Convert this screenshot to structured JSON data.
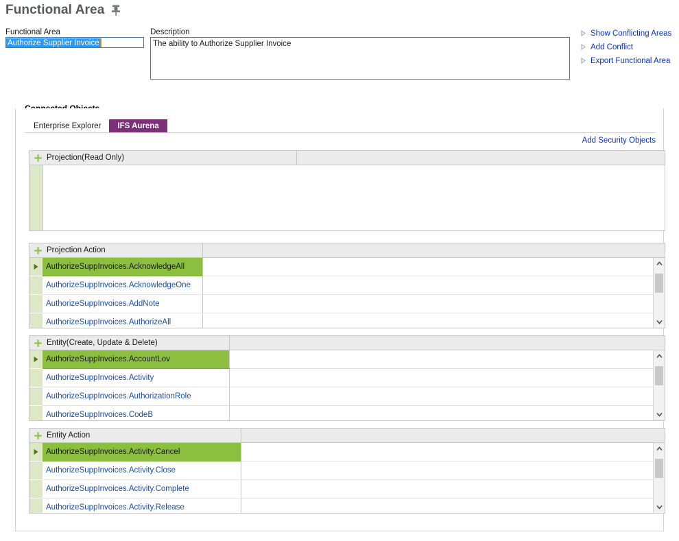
{
  "page": {
    "title": "Functional Area",
    "pin_icon": "pushpin-icon"
  },
  "form": {
    "functional_area_label": "Functional Area",
    "functional_area_value": "Authorize Supplier Invoice",
    "description_label": "Description",
    "description_value": "The ability to Authorize Supplier Invoice"
  },
  "side_links": [
    {
      "label": "Show Conflicting Areas",
      "icon": "triangle-right-icon"
    },
    {
      "label": "Add Conflict",
      "icon": "triangle-right-icon"
    },
    {
      "label": "Export Functional Area",
      "icon": "triangle-right-icon"
    }
  ],
  "connected_objects": {
    "legend": "Connected Objects",
    "tabs": [
      {
        "label": "Enterprise Explorer",
        "active": false
      },
      {
        "label": "IFS Aurena",
        "active": true
      }
    ],
    "add_security_objects_label": "Add Security Objects",
    "colors": {
      "tab_active_bg": "#7c3079",
      "selected_row_bg": "#8cbf3f",
      "gutter_bg": "#dde9c6",
      "link_text": "#1d4ea8",
      "header_bg": "#ebebeb"
    },
    "panels": [
      {
        "title": "Projection(Read Only)",
        "add_icon": "plus-icon",
        "header_col_width": 390,
        "rows": [],
        "has_scrollbar": false
      },
      {
        "title": "Projection Action",
        "add_icon": "plus-icon",
        "header_col_width": 253,
        "has_scrollbar": true,
        "rows": [
          {
            "text": "AuthorizeSuppInvoices.AcknowledgeAll",
            "selected": true
          },
          {
            "text": "AuthorizeSuppInvoices.AcknowledgeOne",
            "selected": false
          },
          {
            "text": "AuthorizeSuppInvoices.AddNote",
            "selected": false
          },
          {
            "text": "AuthorizeSuppInvoices.AuthorizeAll",
            "selected": false
          }
        ]
      },
      {
        "title": "Entity(Create, Update & Delete)",
        "add_icon": "plus-icon",
        "header_col_width": 292,
        "has_scrollbar": true,
        "rows": [
          {
            "text": "AuthorizeSuppInvoices.AccountLov",
            "selected": true
          },
          {
            "text": "AuthorizeSuppInvoices.Activity",
            "selected": false
          },
          {
            "text": "AuthorizeSuppInvoices.AuthorizationRole",
            "selected": false
          },
          {
            "text": "AuthorizeSuppInvoices.CodeB",
            "selected": false
          }
        ]
      },
      {
        "title": "Entity Action",
        "add_icon": "plus-icon",
        "header_col_width": 309,
        "has_scrollbar": true,
        "rows": [
          {
            "text": "AuthorizeSuppInvoices.Activity.Cancel",
            "selected": true
          },
          {
            "text": "AuthorizeSuppInvoices.Activity.Close",
            "selected": false
          },
          {
            "text": "AuthorizeSuppInvoices.Activity.Complete",
            "selected": false
          },
          {
            "text": "AuthorizeSuppInvoices.Activity.Release",
            "selected": false
          }
        ]
      }
    ]
  }
}
